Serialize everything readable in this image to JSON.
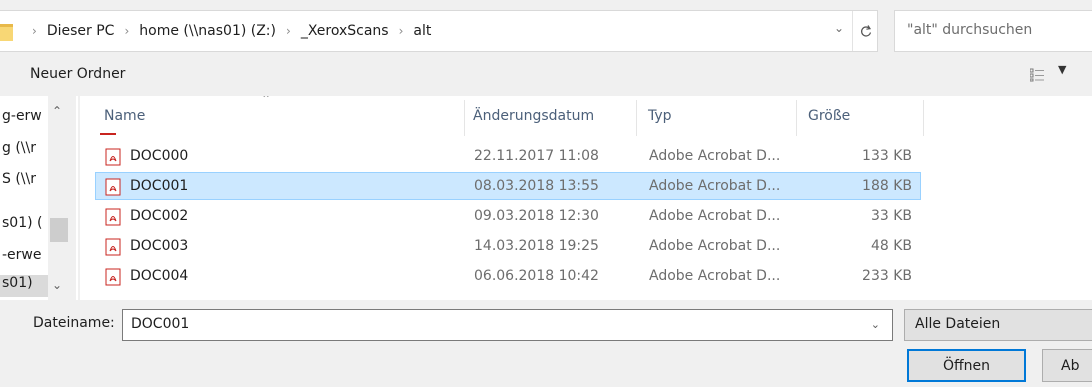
{
  "address_bar": {
    "crumbs": [
      "Dieser PC",
      "home (\\\\nas01) (Z:)",
      "_XeroxScans",
      "alt"
    ],
    "separator": "›"
  },
  "search": {
    "placeholder": "\"alt\" durchsuchen"
  },
  "toolbar": {
    "new_folder_label": "Neuer Ordner"
  },
  "nav_pane": {
    "items": [
      "g-erw",
      "g (\\\\r",
      "S (\\\\r",
      "s01) (",
      "-erwe",
      "s01)"
    ]
  },
  "file_list": {
    "columns": {
      "name": "Name",
      "date": "Änderungsdatum",
      "type": "Typ",
      "size": "Größe"
    },
    "rows": [
      {
        "name": "DOC000",
        "date": "22.11.2017 11:08",
        "type": "Adobe Acrobat D...",
        "size": "133 KB",
        "selected": false
      },
      {
        "name": "DOC001",
        "date": "08.03.2018 13:55",
        "type": "Adobe Acrobat D...",
        "size": "188 KB",
        "selected": true
      },
      {
        "name": "DOC002",
        "date": "09.03.2018 12:30",
        "type": "Adobe Acrobat D...",
        "size": "33 KB",
        "selected": false
      },
      {
        "name": "DOC003",
        "date": "14.03.2018 19:25",
        "type": "Adobe Acrobat D...",
        "size": "48 KB",
        "selected": false
      },
      {
        "name": "DOC004",
        "date": "06.06.2018 10:42",
        "type": "Adobe Acrobat D...",
        "size": "233 KB",
        "selected": false
      }
    ]
  },
  "bottom": {
    "filename_label": "Dateiname:",
    "filename_value": "DOC001",
    "filter_value": "Alle Dateien",
    "open_label": "Öffnen",
    "cancel_label": "Ab"
  },
  "colors": {
    "selection_bg": "#cce8ff",
    "selection_border": "#99d1ff",
    "primary_button_border": "#0078d7",
    "pdf_icon": "#c8241f"
  },
  "icons": {
    "folder": "folder-icon",
    "refresh": "refresh-icon",
    "view": "view-options-icon",
    "file": "pdf-file-icon"
  }
}
